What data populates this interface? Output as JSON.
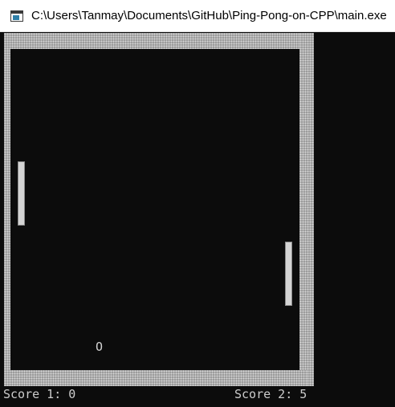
{
  "window": {
    "title": "C:\\Users\\Tanmay\\Documents\\GitHub\\Ping-Pong-on-CPP\\main.exe",
    "icon": "console-window-icon"
  },
  "game": {
    "ball_char": "O",
    "score_1": "Score 1: 0",
    "score_2": "Score 2: 5"
  },
  "colors": {
    "background": "#0c0c0c",
    "wall": "#9a9a9a",
    "paddle": "#d4d4d4",
    "text": "#cccccc"
  }
}
